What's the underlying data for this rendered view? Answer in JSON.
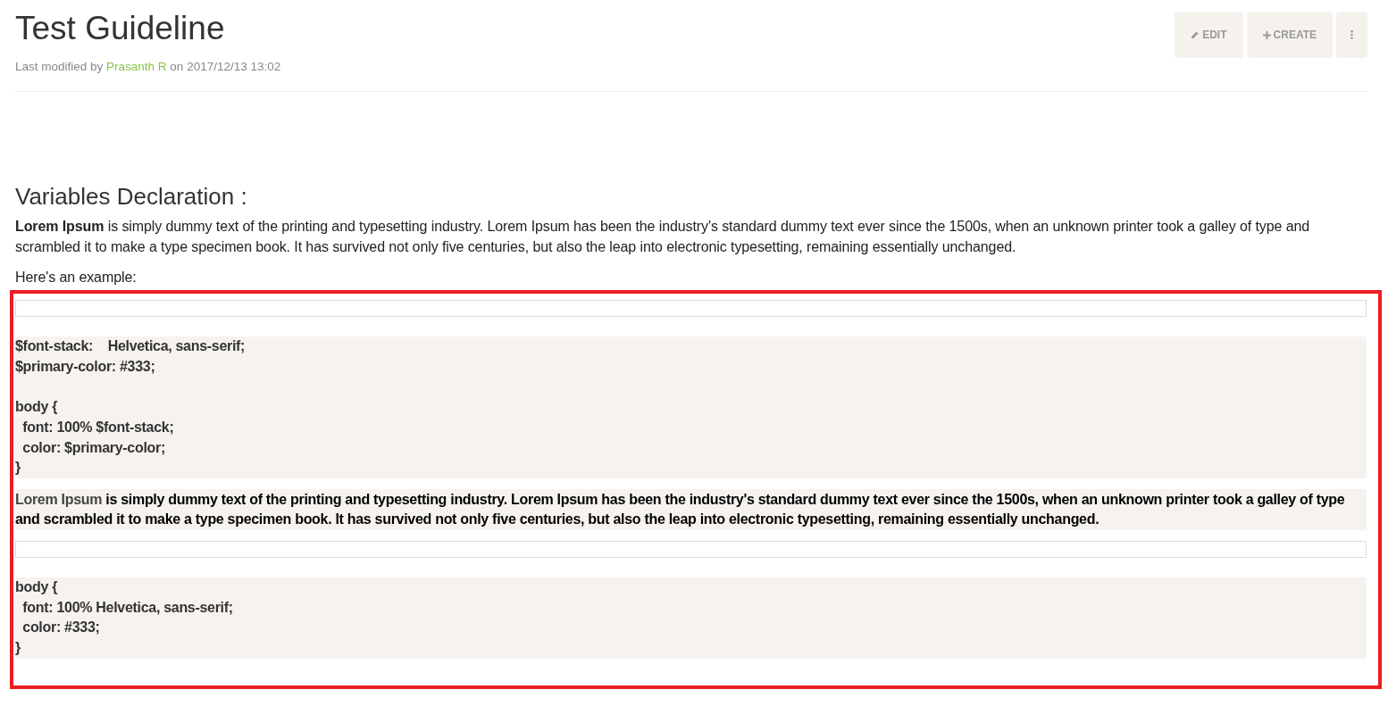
{
  "page": {
    "title": "Test Guideline",
    "modified": {
      "prefix": "Last modified by",
      "author": "Prasanth R",
      "suffix": "on 2017/12/13 13:02"
    }
  },
  "buttons": [
    {
      "kind": "edit",
      "label": "EDIT"
    },
    {
      "kind": "create",
      "label": "CREATE"
    },
    {
      "kind": "more"
    }
  ],
  "section": {
    "heading": "Variables Declaration :",
    "paragraph": "**Lorem Ipsum** is simply dummy text of the printing and typesetting industry. Lorem Ipsum has been the industry's standard dummy text ever since the 1500s, when an unknown printer took a galley of type and scrambled it to make a type specimen book. It has survived not only five centuries, but also the leap into electronic typesetting, remaining essentially unchanged.",
    "example_label": "Here's an example:"
  },
  "highlight": {
    "color": "#ed1c24"
  },
  "blocks": [
    {
      "kind": "empty"
    },
    {
      "kind": "code",
      "groups": [
        [
          "$font-stack:    Helvetica, sans-serif;",
          "$primary-color: #333;"
        ],
        [
          "body {",
          "  font: 100% $font-stack;",
          "  color: $primary-color;",
          "}"
        ]
      ]
    },
    {
      "kind": "text",
      "lead": "Lorem Ipsum",
      "text": "is simply dummy text of the printing and typesetting industry. Lorem Ipsum has been the industry's standard dummy text ever since the 1500s, when an unknown printer took a galley of type and scrambled it to make a type specimen book. It has survived not only five centuries, but also the leap into electronic typesetting, remaining essentially unchanged."
    },
    {
      "kind": "empty"
    },
    {
      "kind": "code",
      "groups": [
        [
          "body {",
          "  font: 100% Helvetica, sans-serif;",
          "  color: #333;",
          "}"
        ]
      ]
    }
  ]
}
